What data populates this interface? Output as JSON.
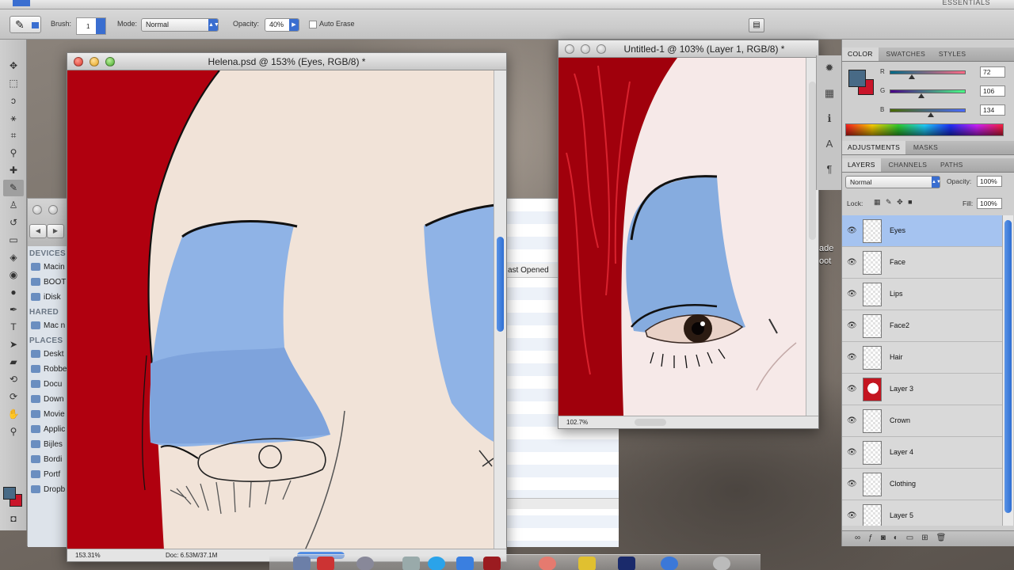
{
  "app": {
    "essentials_label": "ESSENTIALS"
  },
  "options_bar": {
    "brush_label": "Brush:",
    "brush_size": "1",
    "mode_label": "Mode:",
    "mode_value": "Normal",
    "opacity_label": "Opacity:",
    "opacity_value": "40%",
    "auto_erase_label": "Auto Erase"
  },
  "doc1": {
    "title": "Helena.psd @ 153% (Eyes, RGB/8) *",
    "zoom": "153.31%",
    "doc_size": "Doc: 6.53M/37.1M"
  },
  "doc2": {
    "title": "Untitled-1 @ 103% (Layer 1, RGB/8) *",
    "zoom": "102.7%"
  },
  "finder": {
    "sections": [
      {
        "head": "DEVICES",
        "items": [
          "Macin",
          "BOOT",
          "iDisk"
        ]
      },
      {
        "head": "HARED",
        "items": [
          "Mac n"
        ]
      },
      {
        "head": "PLACES",
        "items": [
          "Deskt",
          "Robbe",
          "Docu",
          "Down",
          "Movie",
          "Applic",
          "Bijles",
          "Bordi",
          "Portf",
          "Dropb"
        ]
      }
    ],
    "column_header": "ast Opened"
  },
  "desktop_labels": {
    "line1": "ade",
    "line2": "oot"
  },
  "color_panel": {
    "tabs": [
      "COLOR",
      "SWATCHES",
      "STYLES"
    ],
    "r_label": "R",
    "g_label": "G",
    "b_label": "B",
    "r_value": "72",
    "g_value": "106",
    "b_value": "134",
    "fg_color": "#486a86",
    "bg_color": "#c9152a"
  },
  "adjust_tabs": [
    "ADJUSTMENTS",
    "MASKS"
  ],
  "layers_panel": {
    "tabs": [
      "LAYERS",
      "CHANNELS",
      "PATHS"
    ],
    "blend_mode": "Normal",
    "opacity_label": "Opacity:",
    "opacity_value": "100%",
    "lock_label": "Lock:",
    "fill_label": "Fill:",
    "fill_value": "100%",
    "layers": [
      {
        "name": "Eyes",
        "selected": true
      },
      {
        "name": "Face"
      },
      {
        "name": "Lips"
      },
      {
        "name": "Face2"
      },
      {
        "name": "Hair"
      },
      {
        "name": "Layer 3"
      },
      {
        "name": "Crown"
      },
      {
        "name": "Layer 4"
      },
      {
        "name": "Clothing"
      },
      {
        "name": "Layer 5"
      }
    ],
    "selected_color": "#a5c3f0"
  },
  "colors": {
    "hair_red": "#b0000f",
    "skin": "#f1e3d8",
    "eyeshadow_blue": "#8fb3e6",
    "accent_blue": "#3a6ed0"
  }
}
